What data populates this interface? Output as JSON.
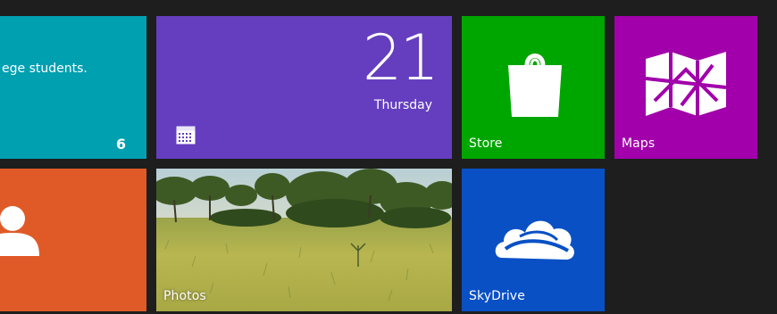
{
  "start_screen": {
    "tiles": {
      "mail": {
        "text": "ege students.",
        "count": "6",
        "color": "#00a0b1",
        "icon": "envelope"
      },
      "calendar": {
        "day": "21",
        "weekday": "Thursday",
        "color": "#643ebf",
        "icon": "calendar-icon"
      },
      "store": {
        "label": "Store",
        "color": "#00a600",
        "icon": "shopping-bag-icon"
      },
      "maps": {
        "label": "Maps",
        "color": "#a100aa",
        "icon": "folded-map-icon"
      },
      "people": {
        "color": "#e05a28",
        "icon": "person-icon"
      },
      "photos": {
        "label": "Photos",
        "icon": "landscape-photo"
      },
      "skydrive": {
        "label": "SkyDrive",
        "color": "#0950c5",
        "icon": "cloud-icon"
      }
    }
  }
}
